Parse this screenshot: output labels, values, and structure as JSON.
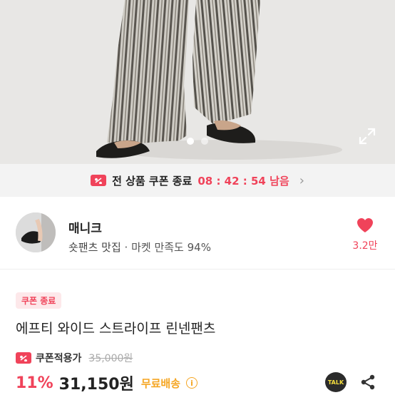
{
  "product_image": {
    "carousel": {
      "page_count": 2,
      "active_index": 0
    }
  },
  "coupon_banner": {
    "icon": "coupon-icon",
    "text": "전 상품 쿠폰 종료",
    "timer": "08 : 42 : 54 남음",
    "chevron": "›"
  },
  "seller": {
    "name": "매니크",
    "tag": "숏팬츠 맛집",
    "separator": " · ",
    "satisfaction": "마켓 만족도 94%",
    "likes": "3.2만"
  },
  "product": {
    "badge": "쿠폰 종료",
    "title": "에프티 와이드 스트라이프 린넨팬츠",
    "price_label": "쿠폰적용가",
    "original_price": "35,000원",
    "discount": "11%",
    "price": "31,150원",
    "shipping": "무료배송",
    "info_icon": "ⓘ"
  },
  "actions": {
    "kakao_label": "TALK"
  },
  "colors": {
    "accent": "#f0435a",
    "shipping": "#f5a623",
    "kakao_bg": "#2b2b2b",
    "kakao_text": "#f6df3e"
  }
}
